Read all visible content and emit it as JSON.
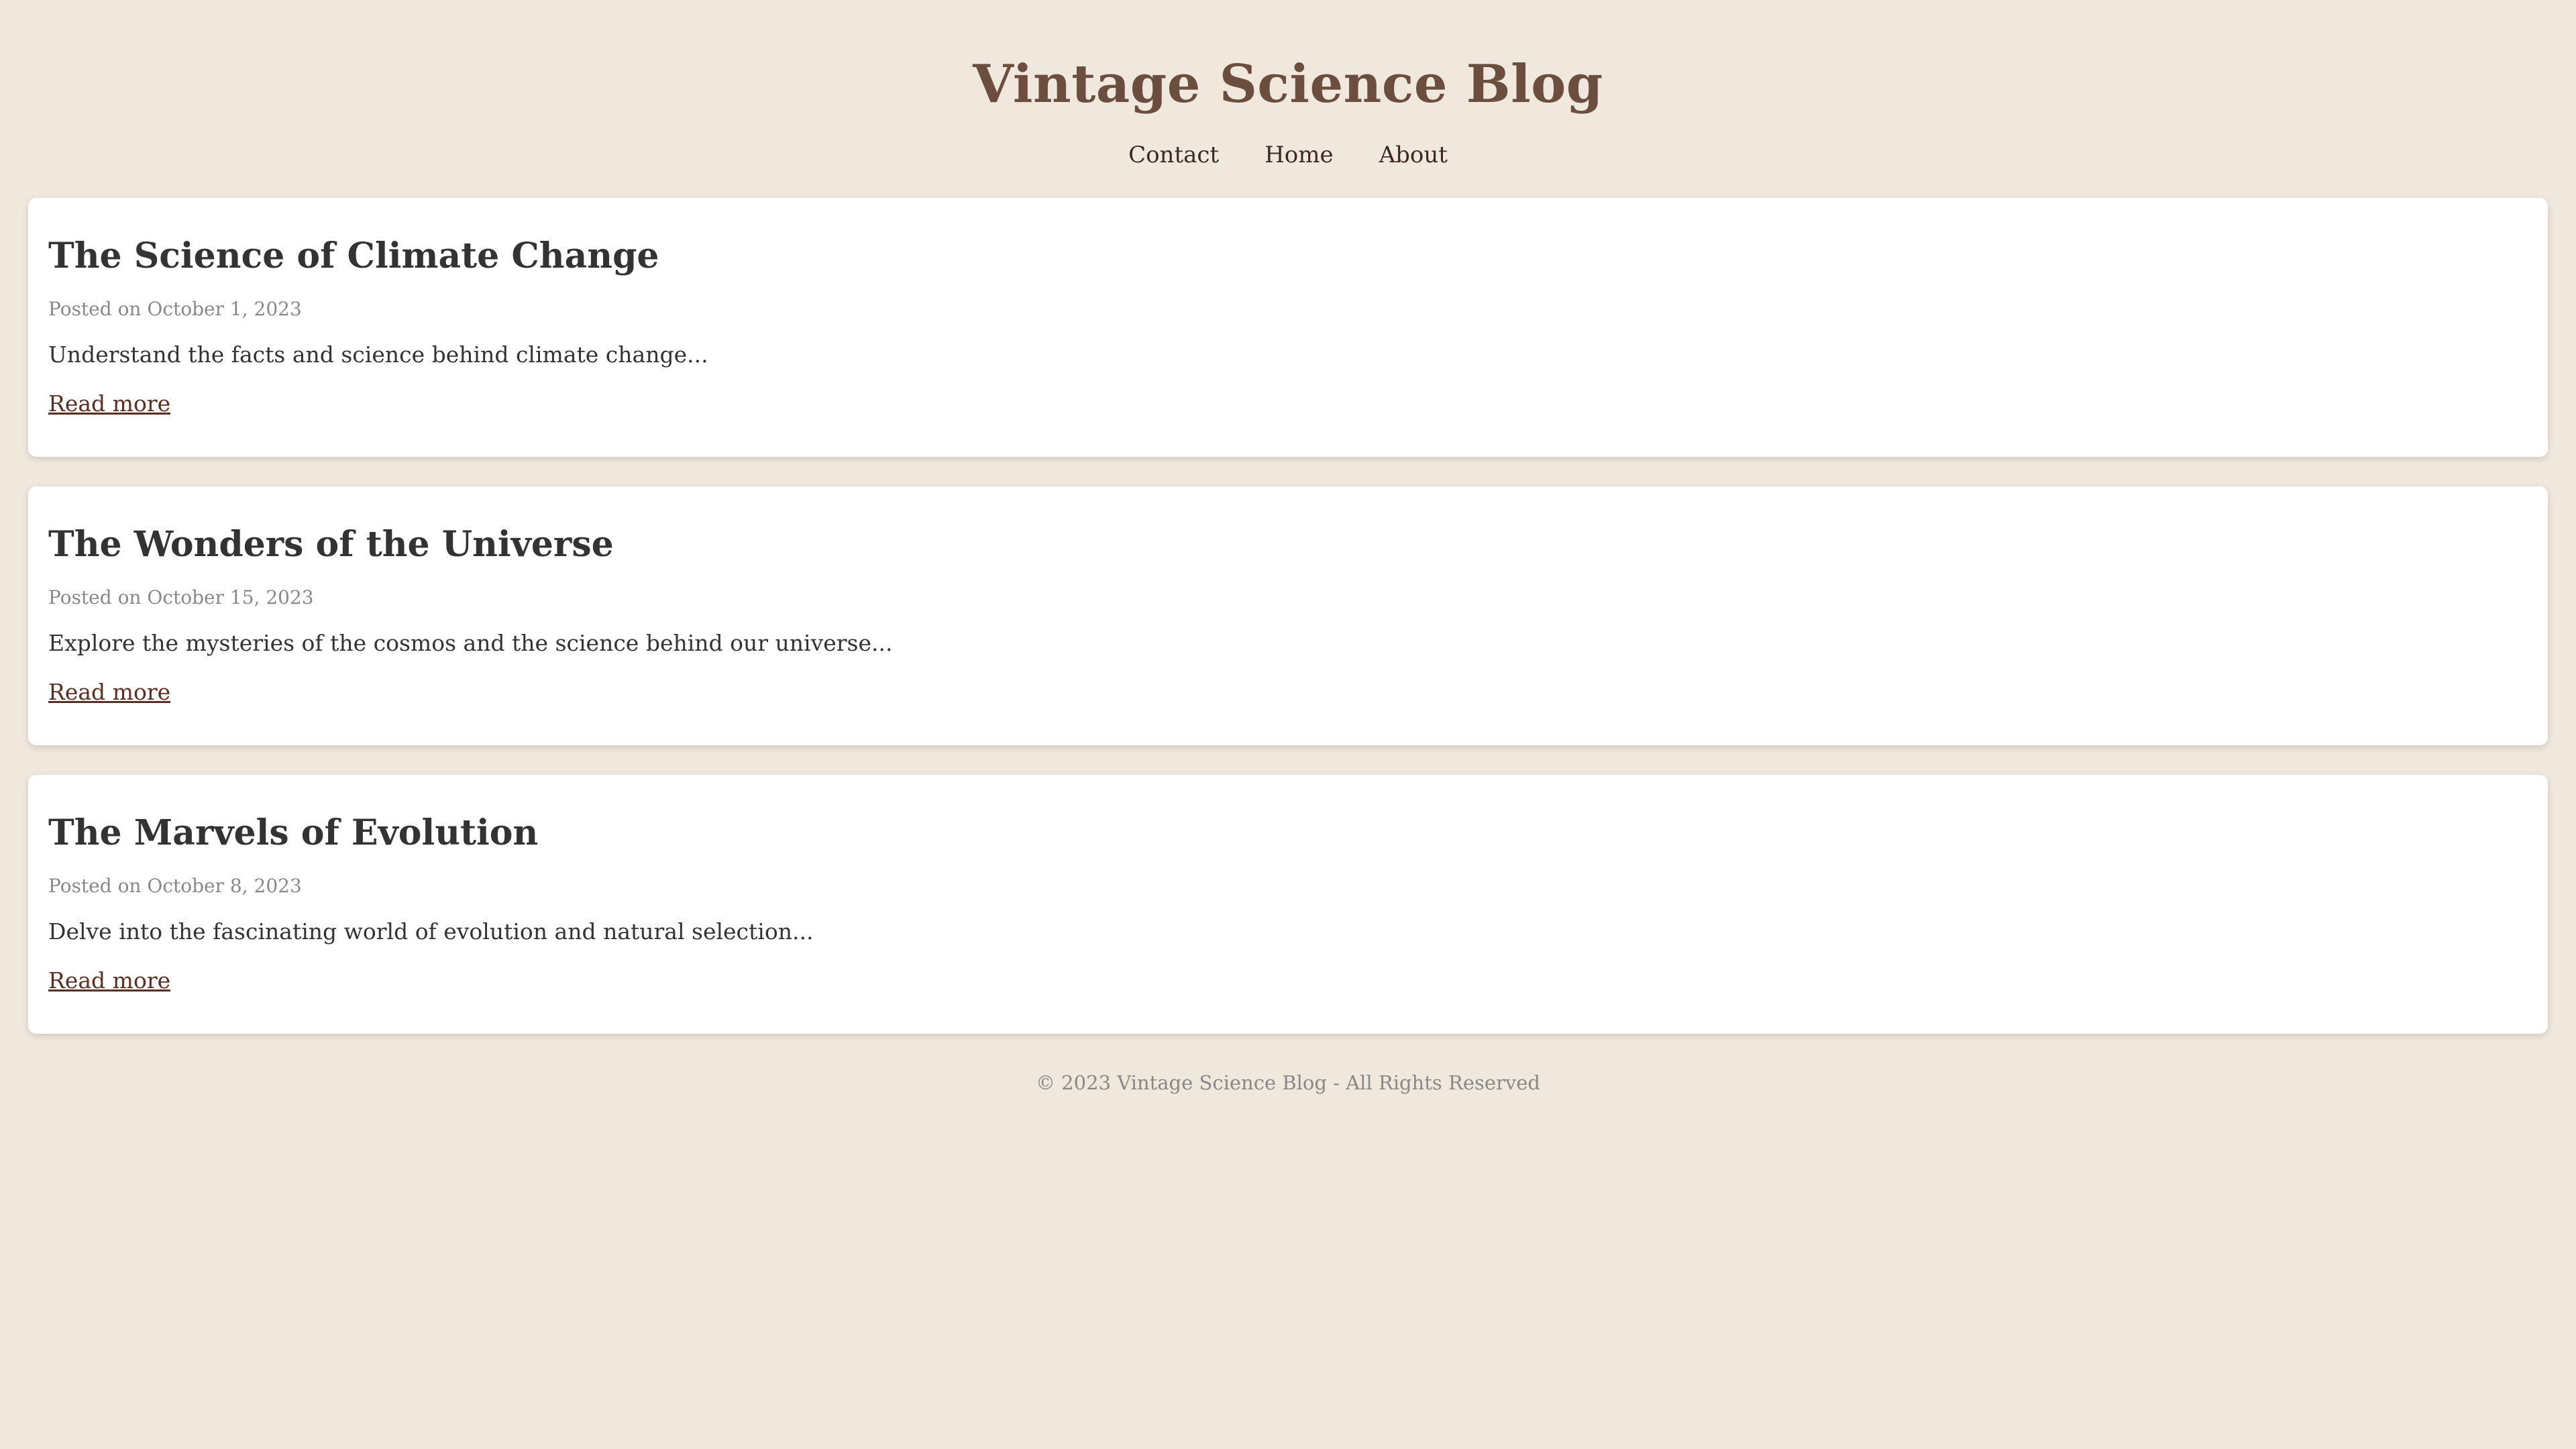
{
  "site": {
    "title": "Vintage Science Blog"
  },
  "nav": {
    "items": [
      {
        "label": "Contact"
      },
      {
        "label": "Home"
      },
      {
        "label": "About"
      }
    ]
  },
  "posts": [
    {
      "title": "The Science of Climate Change",
      "date": "Posted on October 1, 2023",
      "excerpt": "Understand the facts and science behind climate change...",
      "link_label": "Read more"
    },
    {
      "title": "The Wonders of the Universe",
      "date": "Posted on October 15, 2023",
      "excerpt": "Explore the mysteries of the cosmos and the science behind our universe...",
      "link_label": "Read more"
    },
    {
      "title": "The Marvels of Evolution",
      "date": "Posted on October 8, 2023",
      "excerpt": "Delve into the fascinating world of evolution and natural selection...",
      "link_label": "Read more"
    }
  ],
  "footer": {
    "text": "© 2023 Vintage Science Blog - All Rights Reserved"
  },
  "colors": {
    "background": "#f0e8dc",
    "title": "#6b4e3d",
    "card": "#ffffff",
    "link": "#5a2f22",
    "muted": "#888888"
  }
}
